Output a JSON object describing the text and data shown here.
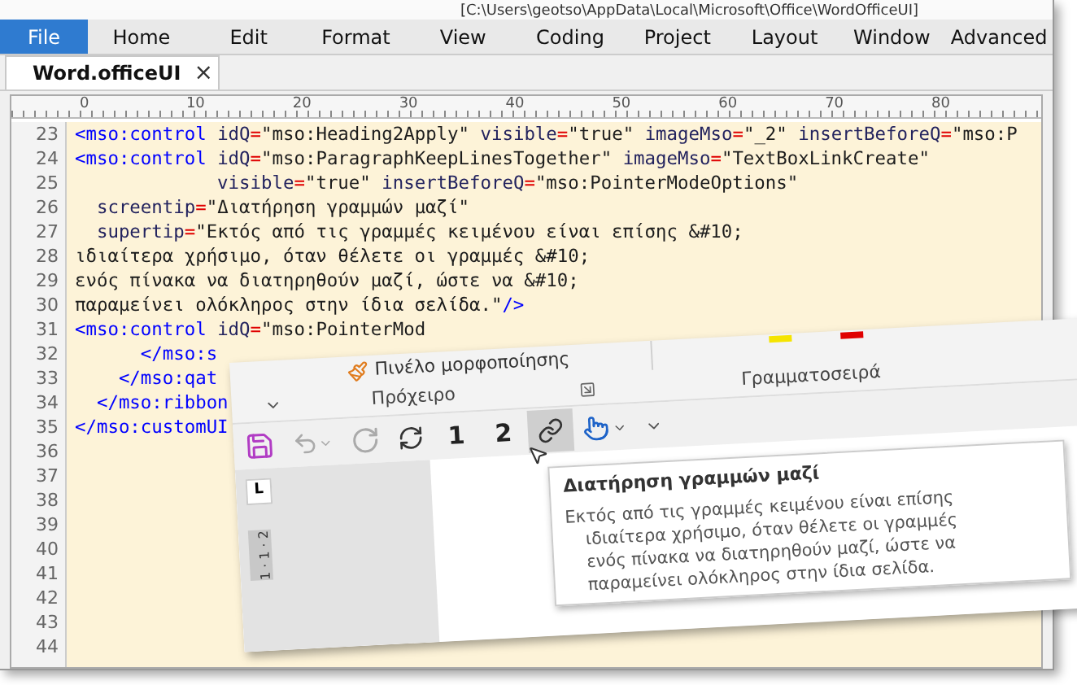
{
  "title_bar": {
    "title": "[C:\\Users\\geotso\\AppData\\Local\\Microsoft\\Office\\WordOfficeUI]"
  },
  "menu": [
    {
      "label": "File",
      "selected": true
    },
    {
      "label": "Home",
      "selected": false
    },
    {
      "label": "Edit",
      "selected": false
    },
    {
      "label": "Format",
      "selected": false
    },
    {
      "label": "View",
      "selected": false
    },
    {
      "label": "Coding",
      "selected": false
    },
    {
      "label": "Project",
      "selected": false
    },
    {
      "label": "Layout",
      "selected": false
    },
    {
      "label": "Window",
      "selected": false
    },
    {
      "label": "Advanced",
      "selected": false
    }
  ],
  "document_tabs": [
    {
      "label": "Word.officeUI",
      "selected": true,
      "close": "×"
    }
  ],
  "ruler": {
    "labels": [
      "0",
      "10",
      "20",
      "30",
      "40",
      "50",
      "60",
      "70",
      "80"
    ]
  },
  "editor": {
    "lines": [
      {
        "number": "23",
        "segments": [
          {
            "kind": "tag",
            "text": "<mso:control"
          },
          {
            "kind": "attr",
            "text": " idQ"
          },
          {
            "kind": "eq",
            "text": "="
          },
          {
            "kind": "str",
            "text": "\"mso:Heading2Apply\""
          },
          {
            "kind": "attr",
            "text": " visible"
          },
          {
            "kind": "eq",
            "text": "="
          },
          {
            "kind": "str",
            "text": "\"true\""
          },
          {
            "kind": "attr",
            "text": " imageMso"
          },
          {
            "kind": "eq",
            "text": "="
          },
          {
            "kind": "str",
            "text": "\"_2\""
          },
          {
            "kind": "attr",
            "text": " insertBeforeQ"
          },
          {
            "kind": "eq",
            "text": "="
          },
          {
            "kind": "str",
            "text": "\"mso:P"
          }
        ]
      },
      {
        "number": "24",
        "segments": [
          {
            "kind": "tag",
            "text": "<mso:control"
          },
          {
            "kind": "attr",
            "text": " idQ"
          },
          {
            "kind": "eq",
            "text": "="
          },
          {
            "kind": "str",
            "text": "\"mso:ParagraphKeepLinesTogether\""
          },
          {
            "kind": "attr",
            "text": " imageMso"
          },
          {
            "kind": "eq",
            "text": "="
          },
          {
            "kind": "str",
            "text": "\"TextBoxLinkCreate\""
          }
        ]
      },
      {
        "number": "25",
        "segments": [
          {
            "kind": "attr",
            "text": "             visible"
          },
          {
            "kind": "eq",
            "text": "="
          },
          {
            "kind": "str",
            "text": "\"true\""
          },
          {
            "kind": "attr",
            "text": " insertBeforeQ"
          },
          {
            "kind": "eq",
            "text": "="
          },
          {
            "kind": "str",
            "text": "\"mso:PointerModeOptions\""
          }
        ]
      },
      {
        "number": "26",
        "segments": [
          {
            "kind": "attr",
            "text": "  screentip"
          },
          {
            "kind": "eq",
            "text": "="
          },
          {
            "kind": "str",
            "text": "\"Διατήρηση γραμμών μαζί\""
          }
        ]
      },
      {
        "number": "27",
        "segments": [
          {
            "kind": "attr",
            "text": "  supertip"
          },
          {
            "kind": "eq",
            "text": "="
          },
          {
            "kind": "str",
            "text": "\"Εκτός από τις γραμμές κειμένου είναι επίσης &#10;"
          }
        ]
      },
      {
        "number": "28",
        "segments": [
          {
            "kind": "str",
            "text": "ιδιαίτερα χρήσιμο, όταν θέλετε οι γραμμές &#10;"
          }
        ]
      },
      {
        "number": "29",
        "segments": [
          {
            "kind": "str",
            "text": "ενός πίνακα να διατηρηθούν μαζί, ώστε να &#10;"
          }
        ]
      },
      {
        "number": "30",
        "segments": [
          {
            "kind": "str",
            "text": "παραμείνει ολόκληρος στην ίδια σελίδα.\""
          },
          {
            "kind": "tag",
            "text": "/>"
          }
        ]
      },
      {
        "number": "31",
        "segments": [
          {
            "kind": "tag",
            "text": "<mso:control"
          },
          {
            "kind": "attr",
            "text": " idQ"
          },
          {
            "kind": "eq",
            "text": "="
          },
          {
            "kind": "str",
            "text": "\"mso:PointerMod"
          }
        ]
      },
      {
        "number": "32",
        "segments": [
          {
            "kind": "tag",
            "text": "      </mso:s"
          }
        ]
      },
      {
        "number": "33",
        "segments": [
          {
            "kind": "tag",
            "text": "    </mso:qat"
          }
        ]
      },
      {
        "number": "34",
        "segments": [
          {
            "kind": "tag",
            "text": "  </mso:ribbon"
          }
        ]
      },
      {
        "number": "35",
        "segments": [
          {
            "kind": "tag",
            "text": "</mso:customUI"
          }
        ]
      },
      {
        "number": "36"
      },
      {
        "number": "37"
      },
      {
        "number": "38"
      },
      {
        "number": "39"
      },
      {
        "number": "40"
      },
      {
        "number": "41"
      },
      {
        "number": "42"
      },
      {
        "number": "43"
      },
      {
        "number": "44"
      }
    ]
  },
  "word_preview": {
    "format_painter": "Πινέλο μορφοποίησης",
    "groups": [
      {
        "label": "Πρόχειρο"
      },
      {
        "label": "Γραμματοσειρά"
      }
    ],
    "quick_access": [
      {
        "kind": "save",
        "highlighted": false
      },
      {
        "kind": "undo",
        "highlighted": false
      },
      {
        "kind": "redo",
        "highlighted": false
      },
      {
        "kind": "refresh",
        "highlighted": false
      },
      {
        "kind": "text",
        "label": "1",
        "highlighted": false
      },
      {
        "kind": "text",
        "label": "2",
        "highlighted": false
      },
      {
        "kind": "link",
        "highlighted": true
      },
      {
        "kind": "touch",
        "highlighted": false
      },
      {
        "kind": "customize",
        "highlighted": false
      }
    ],
    "tab_stop": "L",
    "vertical_ruler": "1 · 1 · 2",
    "tooltip": {
      "title": "Διατήρηση γραμμών μαζί",
      "lines": [
        "Εκτός από τις γραμμές κειμένου είναι επίσης",
        "ιδιαίτερα χρήσιμο, όταν θέλετε οι γραμμές",
        "ενός πίνακα να διατηρηθούν μαζί, ώστε να",
        "παραμείνει ολόκληρος στην ίδια σελίδα."
      ]
    }
  }
}
